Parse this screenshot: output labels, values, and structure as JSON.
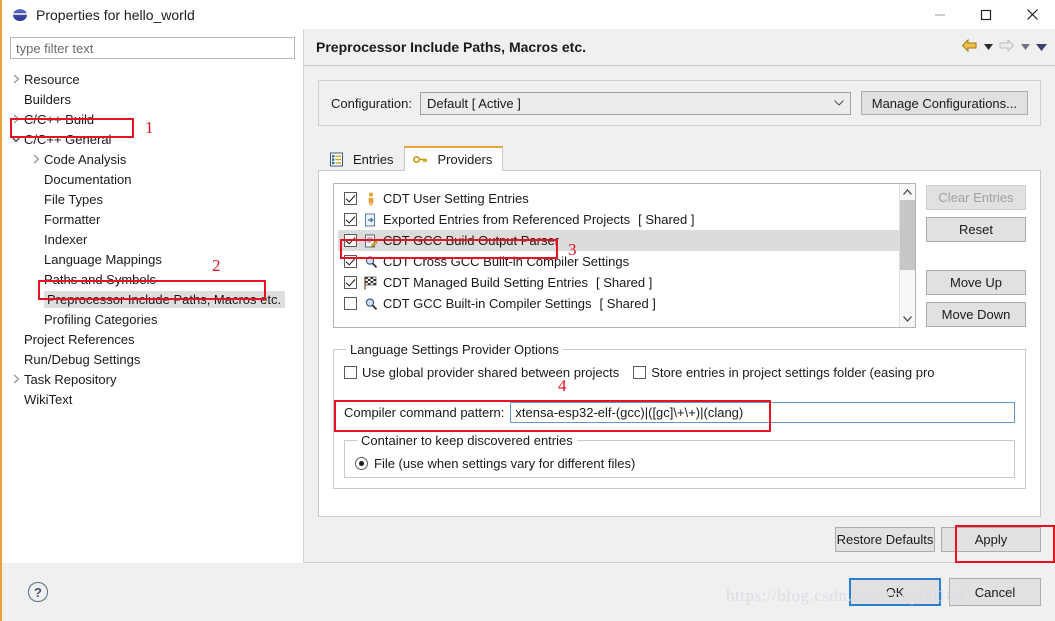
{
  "window": {
    "title": "Properties for hello_world",
    "icon": "eclipse-globe-icon",
    "minimize_label": "—",
    "maximize_label": "□",
    "close_label": "✕"
  },
  "filter": {
    "placeholder": "type filter text",
    "value": ""
  },
  "tree": {
    "items": [
      {
        "label": "Resource",
        "indent": 0,
        "arrow": "collapsed",
        "selected": false
      },
      {
        "label": "Builders",
        "indent": 0,
        "arrow": "none",
        "selected": false
      },
      {
        "label": "C/C++ Build",
        "indent": 0,
        "arrow": "collapsed",
        "selected": false
      },
      {
        "label": "C/C++ General",
        "indent": 0,
        "arrow": "expanded",
        "selected": false
      },
      {
        "label": "Code Analysis",
        "indent": 1,
        "arrow": "collapsed",
        "selected": false
      },
      {
        "label": "Documentation",
        "indent": 1,
        "arrow": "none",
        "selected": false
      },
      {
        "label": "File Types",
        "indent": 1,
        "arrow": "none",
        "selected": false
      },
      {
        "label": "Formatter",
        "indent": 1,
        "arrow": "none",
        "selected": false
      },
      {
        "label": "Indexer",
        "indent": 1,
        "arrow": "none",
        "selected": false
      },
      {
        "label": "Language Mappings",
        "indent": 1,
        "arrow": "none",
        "selected": false
      },
      {
        "label": "Paths and Symbols",
        "indent": 1,
        "arrow": "none",
        "selected": false
      },
      {
        "label": "Preprocessor Include Paths, Macros etc.",
        "indent": 1,
        "arrow": "none",
        "selected": true
      },
      {
        "label": "Profiling Categories",
        "indent": 1,
        "arrow": "none",
        "selected": false
      },
      {
        "label": "Project References",
        "indent": 0,
        "arrow": "none",
        "selected": false
      },
      {
        "label": "Run/Debug Settings",
        "indent": 0,
        "arrow": "none",
        "selected": false
      },
      {
        "label": "Task Repository",
        "indent": 0,
        "arrow": "collapsed",
        "selected": false
      },
      {
        "label": "WikiText",
        "indent": 0,
        "arrow": "none",
        "selected": false
      }
    ]
  },
  "page": {
    "title": "Preprocessor Include Paths, Macros etc.",
    "nav": {
      "back_icon": "back-arrow-icon",
      "back_dropdown_icon": "chevron-down-icon",
      "forward_icon": "forward-arrow-icon",
      "forward_dropdown_icon": "chevron-down-icon",
      "menu_icon": "chevron-down-icon"
    }
  },
  "configuration": {
    "label": "Configuration:",
    "value": "Default  [ Active ]",
    "dropdown_icon": "chevron-down-icon",
    "manage_button": "Manage Configurations..."
  },
  "tabs": [
    {
      "label": "Entries",
      "icon": "entries-list-icon",
      "active": false
    },
    {
      "label": "Providers",
      "icon": "key-icon",
      "active": true
    }
  ],
  "providers": {
    "rows": [
      {
        "label": "CDT User Setting Entries",
        "checked": true,
        "icon": "person-icon",
        "shared": "",
        "selected": false
      },
      {
        "label": "Exported Entries from Referenced Projects",
        "checked": true,
        "icon": "export-icon",
        "shared": "[ Shared ]",
        "selected": false
      },
      {
        "label": "CDT GCC Build Output Parser",
        "checked": true,
        "icon": "document-pencil-icon",
        "shared": "",
        "selected": true
      },
      {
        "label": "CDT Cross GCC Built-in Compiler Settings",
        "checked": true,
        "icon": "magnifier-icon",
        "shared": "",
        "selected": false
      },
      {
        "label": "CDT Managed Build Setting Entries",
        "checked": true,
        "icon": "checkered-flag-icon",
        "shared": "[ Shared ]",
        "selected": false
      },
      {
        "label": "CDT GCC Built-in Compiler Settings",
        "checked": false,
        "icon": "magnifier-icon",
        "shared": "[ Shared ]",
        "selected": false
      }
    ],
    "scroll_up_icon": "chevron-up-icon",
    "scroll_down_icon": "chevron-down-icon"
  },
  "side_buttons": [
    {
      "label": "Clear Entries",
      "disabled": true
    },
    {
      "label": "Reset",
      "disabled": false
    },
    {
      "label": "Move Up",
      "disabled": false
    },
    {
      "label": "Move Down",
      "disabled": false
    }
  ],
  "options_group": {
    "legend": "Language Settings Provider Options",
    "checkbox_global": {
      "label": "Use global provider shared between projects",
      "checked": false
    },
    "checkbox_store": {
      "label": "Store entries in project settings folder (easing pro",
      "checked": false
    },
    "pattern": {
      "label": "Compiler command pattern:",
      "value": "xtensa-esp32-elf-(gcc)|([gc]\\+\\+)|(clang)"
    },
    "container_group": {
      "legend": "Container to keep discovered entries",
      "radio": {
        "label": "File (use when settings vary for different files)",
        "checked": true
      }
    }
  },
  "footer": {
    "restore_defaults": "Restore Defaults",
    "apply": "Apply",
    "ok": "OK",
    "cancel": "Cancel",
    "help_icon": "help-question-icon",
    "watermark": "https://blog.csdn.net/Andy001847"
  },
  "annotations": [
    {
      "number": "1"
    },
    {
      "number": "2"
    },
    {
      "number": "3"
    },
    {
      "number": "4"
    }
  ],
  "colors": {
    "accent_orange": "#e8a33d",
    "annotation_red": "#e81123",
    "focus_blue": "#2a7fd4",
    "selection_gray": "#dcdcdc"
  }
}
